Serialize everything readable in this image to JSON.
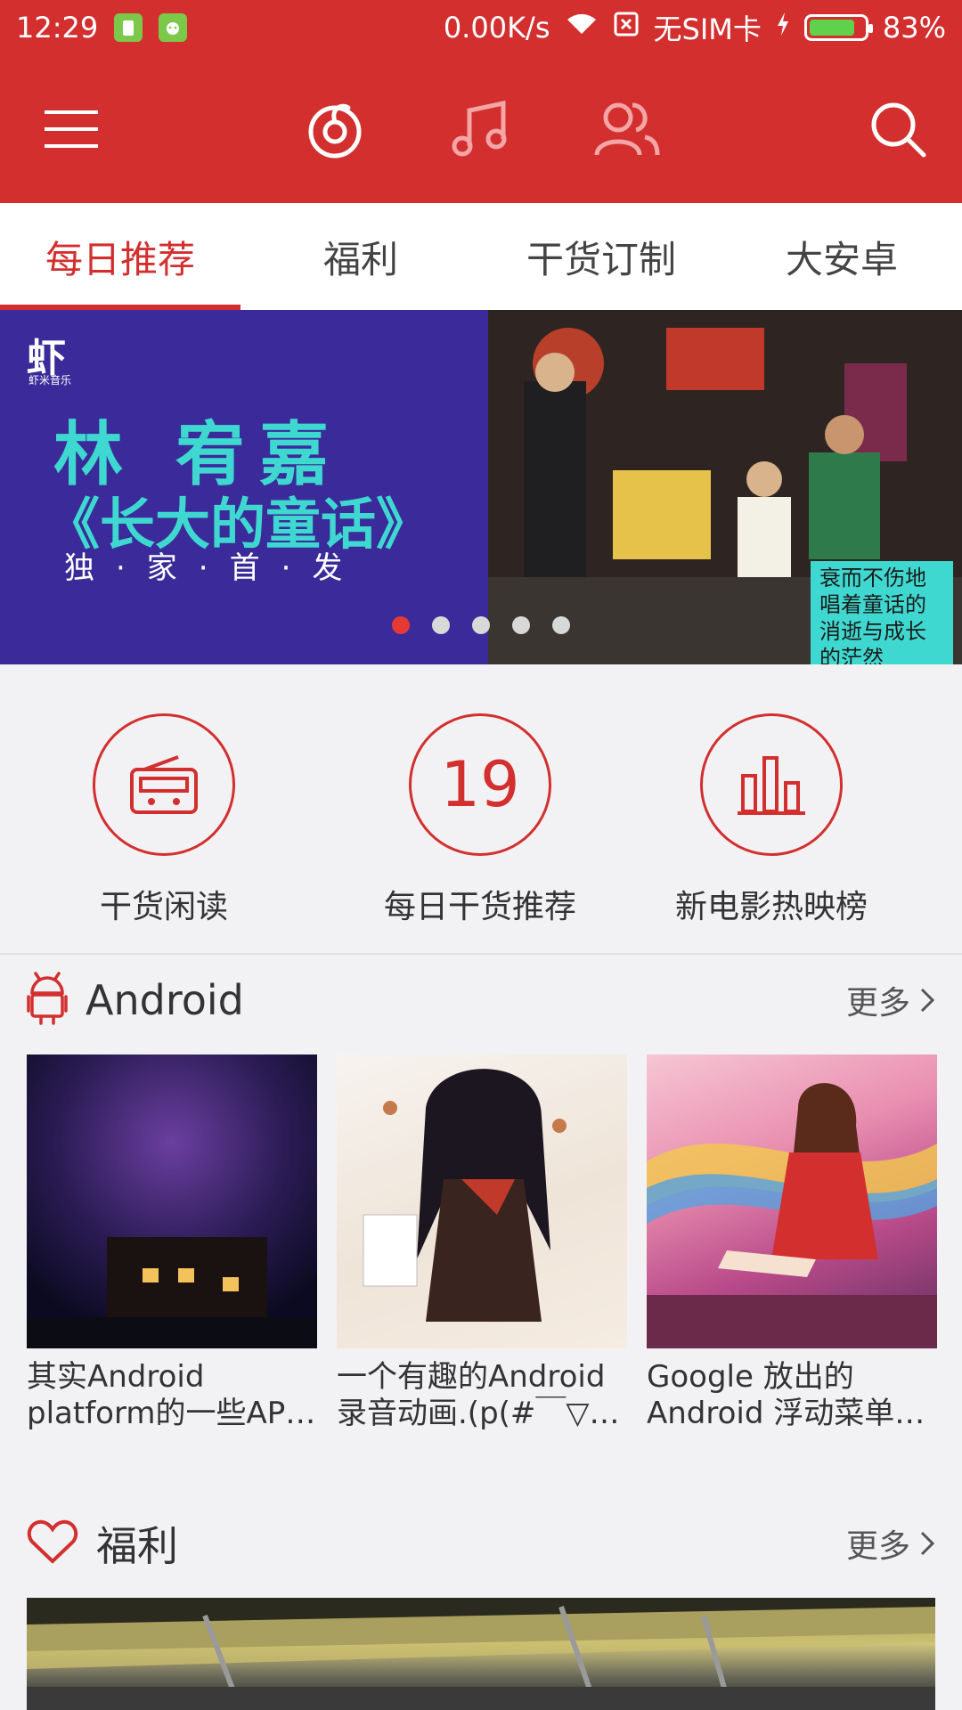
{
  "status": {
    "time": "12:29",
    "speed": "0.00K/s",
    "sim": "无SIM卡",
    "battery_pct": "83%",
    "battery_level": 0.83
  },
  "toolbar": {
    "icons": [
      "menu-icon",
      "netease-music-icon",
      "music-note-icon",
      "friends-icon",
      "search-icon"
    ]
  },
  "tabs": [
    {
      "label": "每日推荐",
      "active": true
    },
    {
      "label": "福利",
      "active": false
    },
    {
      "label": "干货订制",
      "active": false
    },
    {
      "label": "大安卓",
      "active": false
    }
  ],
  "banner": {
    "brand": "虾",
    "brand_sub": "虾米音乐",
    "artist": "林 宥嘉",
    "album": "《长大的童话》",
    "exclusive": "独·家·首·发",
    "quote": "衰而不伤地唱着童话的消逝与成长的茫然",
    "dots": 5,
    "active_dot": 0
  },
  "quick_actions": [
    {
      "label": "干货闲读",
      "icon": "radio-icon"
    },
    {
      "label": "每日干货推荐",
      "value": "19"
    },
    {
      "label": "新电影热映榜",
      "icon": "bar-chart-icon"
    }
  ],
  "sections": {
    "android": {
      "title": "Android",
      "more": "更多",
      "items": [
        {
          "title": "其实Android platform的一些AP…"
        },
        {
          "title": "一个有趣的Android 录音动画.(p(#￣▽…"
        },
        {
          "title": "Google 放出的 Android 浮动菜单…"
        }
      ]
    },
    "welfare": {
      "title": "福利",
      "more": "更多"
    }
  },
  "colors": {
    "primary": "#d32f2f",
    "accent": "#3fd8d0"
  }
}
